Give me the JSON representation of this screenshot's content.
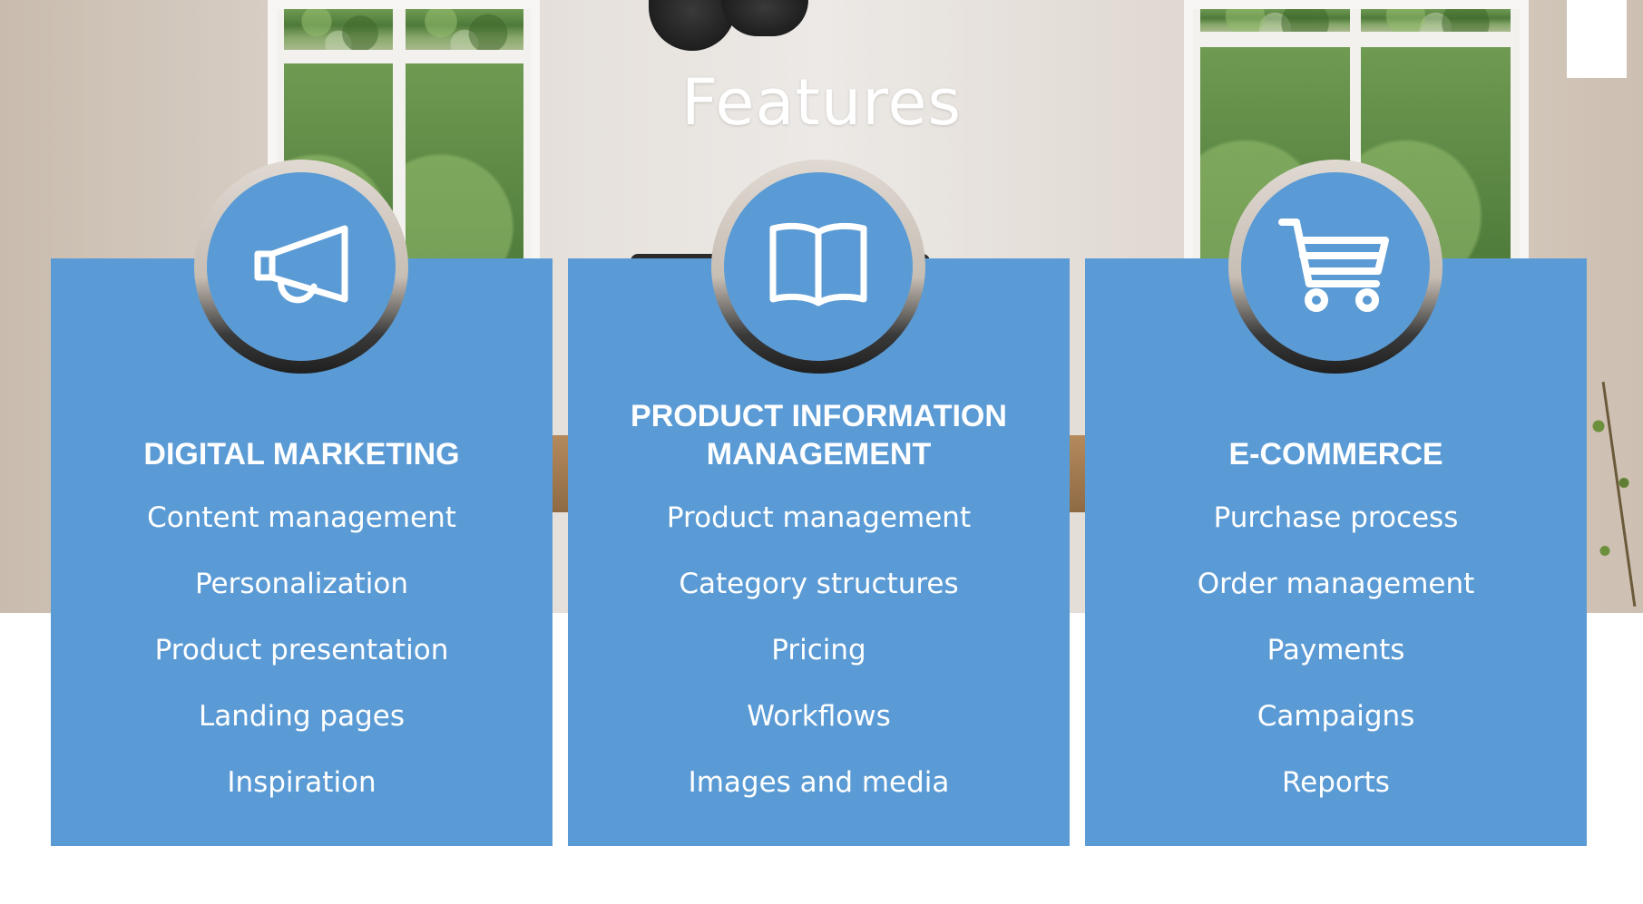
{
  "title": "Features",
  "colors": {
    "card": "#5b9bd5",
    "text": "#ffffff",
    "background": "#ffffff"
  },
  "cards": [
    {
      "id": "digital-marketing",
      "icon": "megaphone-icon",
      "title_lines": [
        "DIGITAL MARKETING"
      ],
      "items": [
        "Content management",
        "Personalization",
        "Product presentation",
        "Landing pages",
        "Inspiration"
      ]
    },
    {
      "id": "product-information-management",
      "icon": "book-icon",
      "title_lines": [
        "PRODUCT INFORMATION",
        "MANAGEMENT"
      ],
      "items": [
        "Product management",
        "Category structures",
        "Pricing",
        "Workflows",
        "Images and media"
      ]
    },
    {
      "id": "e-commerce",
      "icon": "shopping-cart-icon",
      "title_lines": [
        "E-COMMERCE"
      ],
      "items": [
        "Purchase process",
        "Order management",
        "Payments",
        "Campaigns",
        "Reports"
      ]
    }
  ]
}
